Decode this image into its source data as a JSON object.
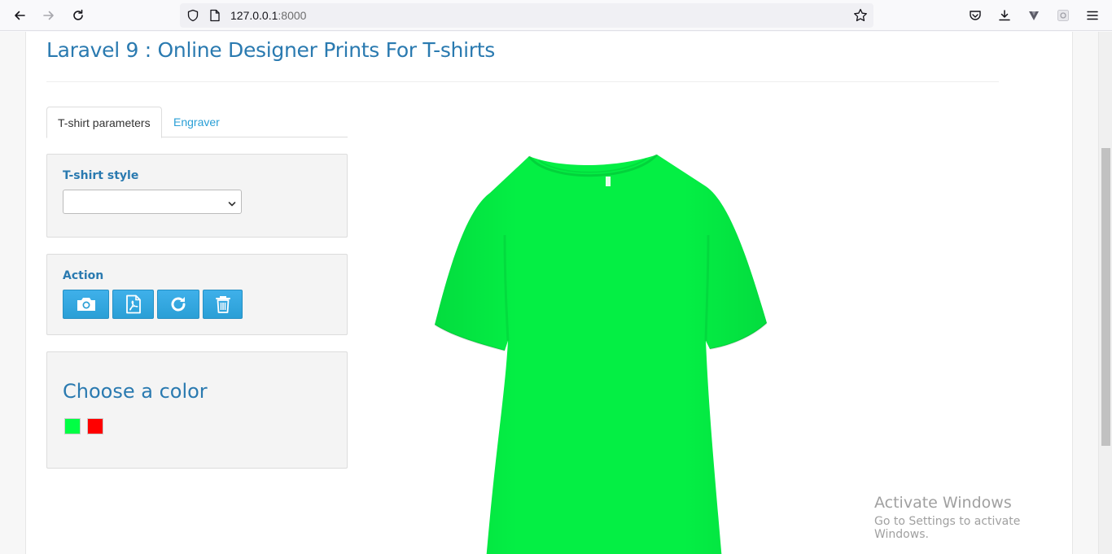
{
  "browser": {
    "url_host": "127.0.0.1",
    "url_port": ":8000"
  },
  "page": {
    "title": "Laravel 9 : Online Designer Prints For T-shirts",
    "tabs": [
      {
        "label": "T-shirt parameters",
        "active": true
      },
      {
        "label": "Engraver",
        "active": false
      }
    ],
    "style_panel": {
      "label": "T-shirt style",
      "selected": ""
    },
    "action_panel": {
      "label": "Action",
      "buttons": [
        {
          "icon": "camera-icon"
        },
        {
          "icon": "pdf-file-icon"
        },
        {
          "icon": "refresh-icon"
        },
        {
          "icon": "trash-icon"
        }
      ]
    },
    "color_panel": {
      "title": "Choose a color",
      "colors": [
        "#00ff44",
        "#ff0000"
      ]
    },
    "tshirt_color": "#04ef44"
  },
  "watermark": {
    "line1": "Activate Windows",
    "line2": "Go to Settings to activate Windows."
  }
}
